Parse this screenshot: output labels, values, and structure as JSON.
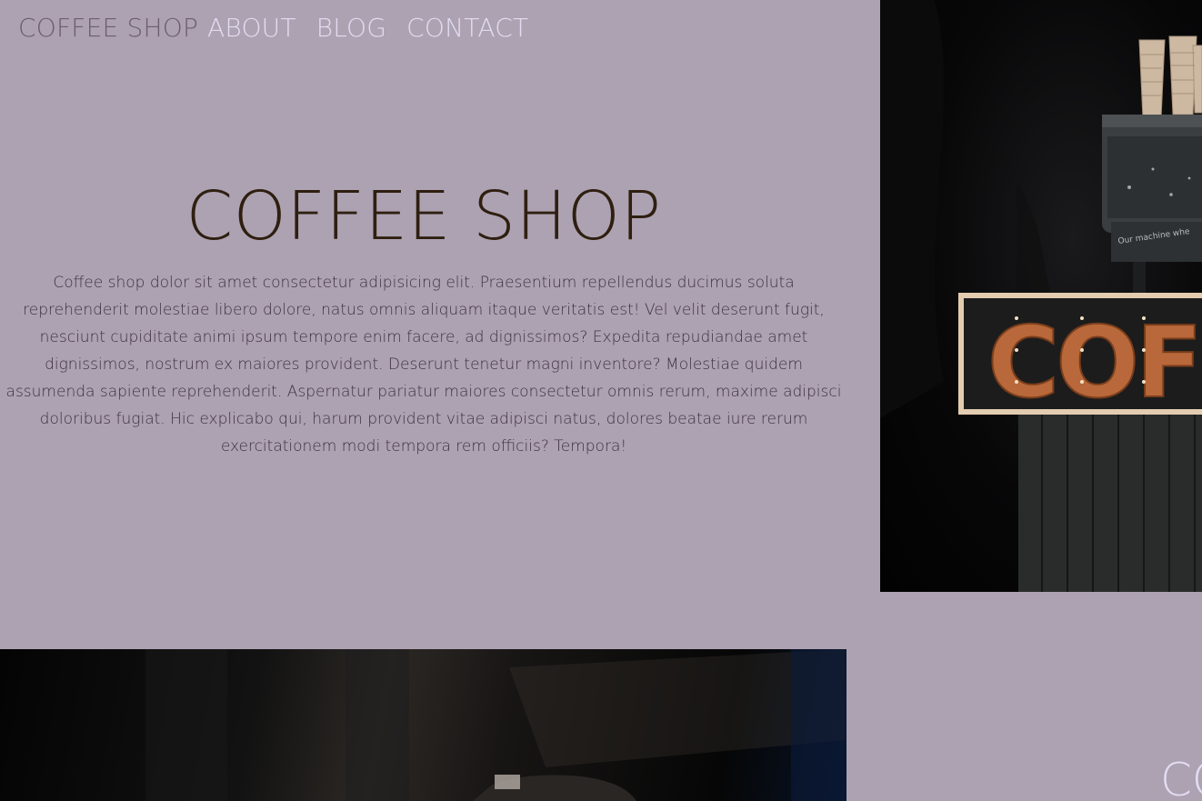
{
  "nav": {
    "brand": "COFFEE SHOP",
    "links": [
      "ABOUT",
      "BLOG",
      "CONTACT"
    ]
  },
  "hero": {
    "title": "COFFEE SHOP",
    "body": "Coffee shop dolor sit amet consectetur adipisicing elit. Praesentium repellendus ducimus soluta reprehenderit molestiae libero dolore, natus omnis aliquam itaque veritatis est! Vel velit deserunt fugit, nesciunt cupiditate animi ipsum tempore enim facere, ad dignissimos? Expedita repudiandae amet dignissimos, nostrum ex maiores provident. Deserunt tenetur magni inventore? Molestiae quidem assumenda sapiente reprehenderit. Aspernatur pariatur maiores consectetur omnis rerum, maxime adipisci doloribus fugiat. Hic explicabo qui, harum provident vitae adipisci natus, dolores beatae iure rerum exercitationem modi tempora rem officiis? Tempora!"
  },
  "images": {
    "right_sign_text": "COF",
    "machine_chalk_text": "Our machine whe"
  },
  "section2": {
    "partial_heading": "CO"
  },
  "colors": {
    "background": "#ada2b2",
    "title": "#2e1f10",
    "nav_brand": "#6b5f6f",
    "nav_link": "#e2dcf2",
    "sign_letters": "#b8683a"
  }
}
